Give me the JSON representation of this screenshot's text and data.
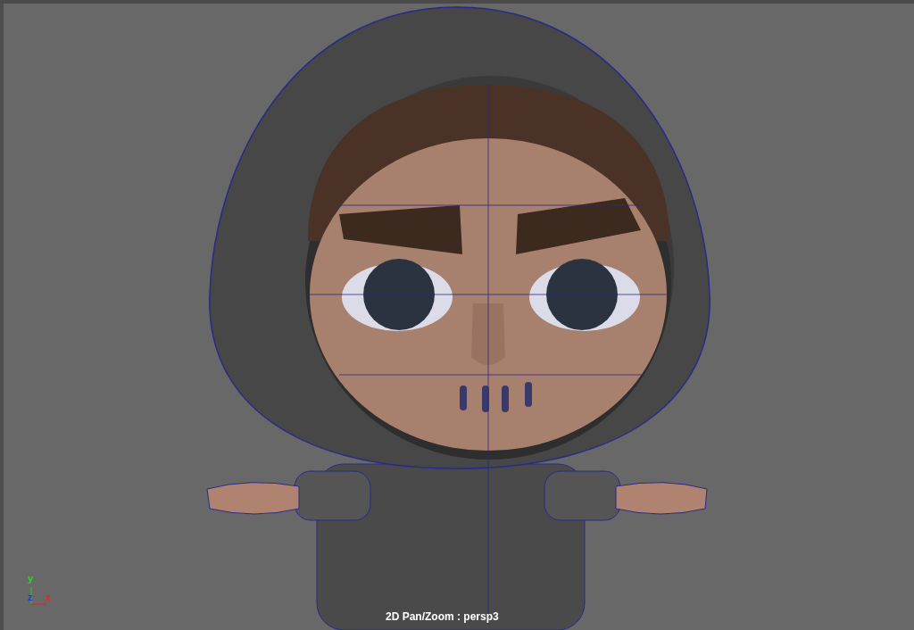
{
  "viewport": {
    "camera_label": "2D Pan/Zoom : persp3"
  },
  "axis_gizmo": {
    "labels": [
      "y",
      "z",
      "x"
    ]
  }
}
